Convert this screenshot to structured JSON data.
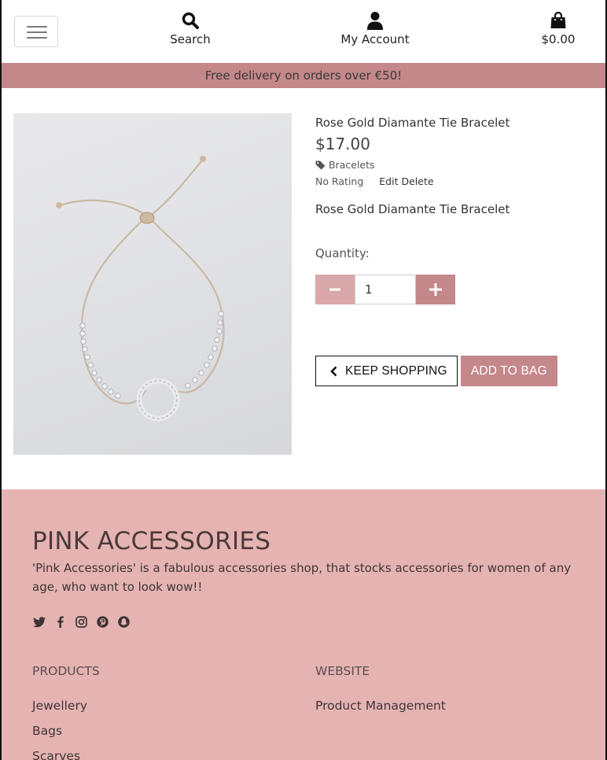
{
  "header": {
    "menu_toggle": "menu",
    "search_label": "Search",
    "account_label": "My Account",
    "bag_total": "$0.00"
  },
  "banner": {
    "text": "Free delivery on orders over €50!"
  },
  "product": {
    "name": "Rose Gold Diamante Tie Bracelet",
    "price": "$17.00",
    "category": "Bracelets",
    "rating": "No Rating",
    "edit_label": "Edit",
    "delete_label": "Delete",
    "description": "Rose Gold Diamante Tie Bracelet",
    "quantity_label": "Quantity:",
    "quantity_value": "1",
    "keep_shopping_label": "KEEP SHOPPING",
    "add_to_bag_label": "ADD TO BAG"
  },
  "footer": {
    "title": "PINK ACCESSORIES",
    "text": "'Pink Accessories' is a fabulous accessories shop, that stocks accessories for women of any age, who want to look wow!!",
    "social_icons": [
      "twitter-icon",
      "facebook-icon",
      "instagram-icon",
      "pinterest-icon",
      "snapchat-icon"
    ],
    "products_heading": "PRODUCTS",
    "products_links": [
      "Jewellery",
      "Bags",
      "Scarves"
    ],
    "website_heading": "WEBSITE",
    "website_links": [
      "Product Management"
    ]
  },
  "colors": {
    "brand_pink": "#c4878a",
    "footer_pink": "#e6b3b3",
    "minus_pink": "#d9a8aa"
  }
}
